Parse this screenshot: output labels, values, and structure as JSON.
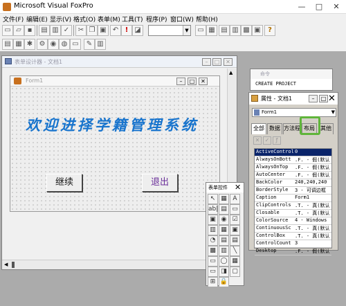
{
  "app": {
    "title": "Microsoft Visual FoxPro"
  },
  "window_controls": {
    "minimize": "—",
    "maximize": "□",
    "close": "✕"
  },
  "menu": [
    "文件(F)",
    "编辑(E)",
    "显示(V)",
    "格式(O)",
    "表单(M)",
    "工具(T)",
    "程序(P)",
    "窗口(W)",
    "帮助(H)"
  ],
  "form_designer": {
    "title": "表单设计器 - 文档1",
    "form_title": "Form1",
    "heading": "欢迎进择学籍管理系统",
    "button_left": "继续",
    "button_right": "退出"
  },
  "command_window": {
    "title": "命令",
    "content": "CREATE PROJECT"
  },
  "properties": {
    "title": "属性 - 文档1",
    "object_select": "Form1",
    "tabs": [
      "全部",
      "数据",
      "方法程",
      "布局",
      "其他"
    ],
    "highlighted_tab_color": "#5fb53a",
    "rows": [
      {
        "name": "ActiveControl",
        "value": "0",
        "selected": true
      },
      {
        "name": "AlwaysOnBott",
        "value": ".F. - 假(默认"
      },
      {
        "name": "AlwaysOnTop",
        "value": ".F. - 假(默认"
      },
      {
        "name": "AutoCenter",
        "value": ".F. - 假(默认"
      },
      {
        "name": "BackColor",
        "value": "240,240,240"
      },
      {
        "name": "BorderStyle",
        "value": "3 - 可调边框"
      },
      {
        "name": "Caption",
        "value": "Form1"
      },
      {
        "name": "ClipControls",
        "value": ".T. - 真(默认"
      },
      {
        "name": "Closable",
        "value": ".T. - 真(默认"
      },
      {
        "name": "ColorSource",
        "value": "4 - Windows"
      },
      {
        "name": "ContinuousSc",
        "value": ".T. - 真(默认"
      },
      {
        "name": "ControlBox",
        "value": ".T. - 真(默认"
      },
      {
        "name": "ControlCount",
        "value": "3"
      },
      {
        "name": "Desktop",
        "value": ".F. - 假(默认"
      }
    ]
  },
  "form_controls": {
    "title": "表单控件",
    "tools": [
      "↖",
      "▦",
      "A",
      "ab|",
      "▤",
      "▭",
      "▣",
      "◉",
      "☑",
      "▥",
      "▦",
      "▣",
      "◔",
      "▤",
      "▤",
      "▩",
      "▥",
      "╲",
      "▭",
      "◯",
      "▦",
      "▭",
      "◨",
      "▢",
      "⊞",
      "🔒"
    ]
  },
  "accent": {
    "blue_heading": "#1874cd",
    "selection": "#0a246a",
    "purple_text": "#6a2f9a"
  }
}
